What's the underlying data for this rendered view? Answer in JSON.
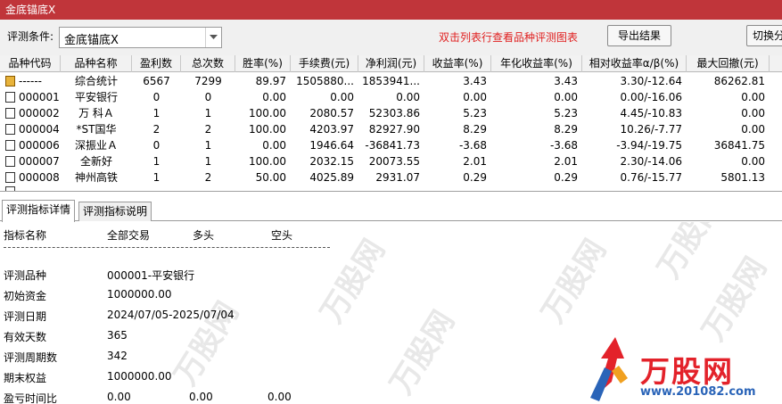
{
  "window": {
    "title": "金底锚底X"
  },
  "toolbar": {
    "condition_label": "评测条件:",
    "condition_value": "金底锚底X",
    "hint": "双击列表行查看品种评测图表",
    "export_label": "导出结果",
    "switch_label": "切换分"
  },
  "table": {
    "columns": [
      "品种代码",
      "品种名称",
      "盈利数",
      "总次数",
      "胜率(%)",
      "手续费(元)",
      "净利润(元)",
      "收益率(%)",
      "年化收益率(%)",
      "相对收益率α/β(%)",
      "最大回撤(元)"
    ],
    "rows": [
      {
        "code": "------",
        "name": "综合统计",
        "wins": "6567",
        "total": "7299",
        "winrate": "89.97",
        "fee": "1505880...",
        "profit": "1853941...",
        "ret": "3.43",
        "annual": "3.43",
        "rel": "3.30/-12.64",
        "dd": "86262.81",
        "summary": true
      },
      {
        "code": "000001",
        "name": "平安银行",
        "wins": "0",
        "total": "0",
        "winrate": "0.00",
        "fee": "0.00",
        "profit": "0.00",
        "ret": "0.00",
        "annual": "0.00",
        "rel": "0.00/-16.06",
        "dd": "0.00"
      },
      {
        "code": "000002",
        "name": "万 科Ａ",
        "wins": "1",
        "total": "1",
        "winrate": "100.00",
        "fee": "2080.57",
        "profit": "52303.86",
        "ret": "5.23",
        "annual": "5.23",
        "rel": "4.45/-10.83",
        "dd": "0.00"
      },
      {
        "code": "000004",
        "name": "*ST国华",
        "wins": "2",
        "total": "2",
        "winrate": "100.00",
        "fee": "4203.97",
        "profit": "82927.90",
        "ret": "8.29",
        "annual": "8.29",
        "rel": "10.26/-7.77",
        "dd": "0.00"
      },
      {
        "code": "000006",
        "name": "深振业Ａ",
        "wins": "0",
        "total": "1",
        "winrate": "0.00",
        "fee": "1946.64",
        "profit": "-36841.73",
        "ret": "-3.68",
        "annual": "-3.68",
        "rel": "-3.94/-19.75",
        "dd": "36841.75"
      },
      {
        "code": "000007",
        "name": "全新好",
        "wins": "1",
        "total": "1",
        "winrate": "100.00",
        "fee": "2032.15",
        "profit": "20073.55",
        "ret": "2.01",
        "annual": "2.01",
        "rel": "2.30/-14.06",
        "dd": "0.00"
      },
      {
        "code": "000008",
        "name": "神州高铁",
        "wins": "1",
        "total": "2",
        "winrate": "50.00",
        "fee": "4025.89",
        "profit": "2931.07",
        "ret": "0.29",
        "annual": "0.29",
        "rel": "0.76/-15.77",
        "dd": "5801.13"
      }
    ]
  },
  "tabs": [
    "评测指标详情",
    "评测指标说明"
  ],
  "detail": {
    "header": {
      "metric": "指标名称",
      "all": "全部交易",
      "long": "多头",
      "short": "空头"
    },
    "items": [
      {
        "label": "评测品种",
        "value": "000001-平安银行"
      },
      {
        "label": "初始资金",
        "value": "1000000.00"
      },
      {
        "label": "评测日期",
        "value": "2024/07/05-2025/07/04"
      },
      {
        "label": "有效天数",
        "value": "365"
      },
      {
        "label": "评测周期数",
        "value": " 342"
      },
      {
        "label": "期末权益",
        "value": "1000000.00"
      },
      {
        "label": "盈亏时间比",
        "value": " 0.00",
        "value2": "0.00",
        "value3": "0.00"
      }
    ]
  },
  "watermark": {
    "text": "万股网",
    "brand": "万股网",
    "url": "www.201082.com"
  },
  "colors": {
    "titlebar": "#c0353a",
    "hint": "#e02020",
    "brand_red": "#e3222a",
    "brand_blue": "#2a64b8"
  }
}
